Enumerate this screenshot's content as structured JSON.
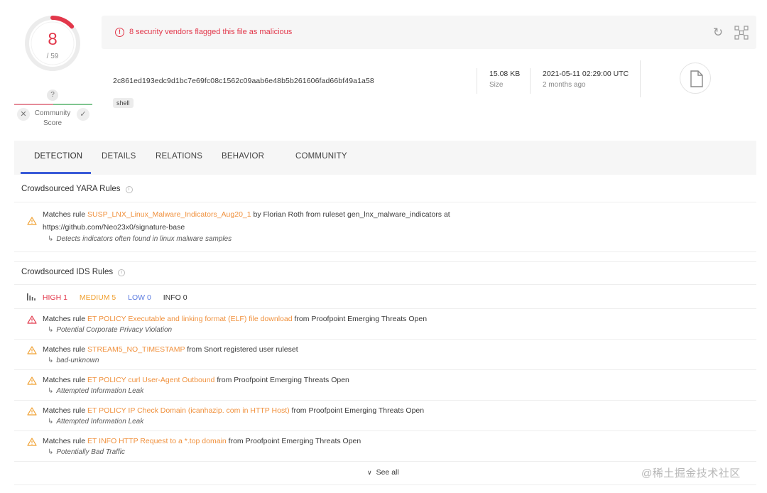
{
  "score": {
    "detected": "8",
    "total": "/ 59",
    "detected_fraction": 0.1356
  },
  "community": {
    "question": "?",
    "label_line1": "Community",
    "label_line2": "Score",
    "down": "✕",
    "up": "✓"
  },
  "alert": {
    "text": "8 security vendors flagged this file as malicious",
    "icon": "!"
  },
  "file": {
    "hash": "2c861ed193edc9d1bc7e69fc08c1562c09aab6e48b5b261606fad66bf49a1a58",
    "tag": "shell",
    "size_value": "15.08 KB",
    "size_label": "Size",
    "date_value": "2021-05-11 02:29:00 UTC",
    "date_label": "2 months ago"
  },
  "tabs": [
    "DETECTION",
    "DETAILS",
    "RELATIONS",
    "BEHAVIOR",
    "COMMUNITY"
  ],
  "yara": {
    "title": "Crowdsourced YARA Rules",
    "rule": {
      "prefix": "Matches rule ",
      "name": "SUSP_LNX_Linux_Malware_Indicators_Aug20_1",
      "suffix": " by Florian Roth from ruleset gen_lnx_malware_indicators at",
      "line2": "https://github.com/Neo23x0/signature-base",
      "desc": "Detects indicators often found in linux malware samples"
    }
  },
  "ids": {
    "title": "Crowdsourced IDS Rules",
    "severity": {
      "high": "HIGH 1",
      "medium": "MEDIUM 5",
      "low": "LOW 0",
      "info": "INFO 0"
    },
    "rules": [
      {
        "prefix": "Matches rule ",
        "name": "ET POLICY Executable and linking format (ELF) file download",
        "suffix": " from Proofpoint Emerging Threats Open",
        "desc": "Potential Corporate Privacy Violation",
        "level": "high"
      },
      {
        "prefix": "Matches rule ",
        "name": "STREAM5_NO_TIMESTAMP",
        "suffix": " from Snort registered user ruleset",
        "desc": "bad-unknown",
        "level": "medium"
      },
      {
        "prefix": "Matches rule ",
        "name": "ET POLICY curl User-Agent Outbound",
        "suffix": " from Proofpoint Emerging Threats Open",
        "desc": "Attempted Information Leak",
        "level": "medium"
      },
      {
        "prefix": "Matches rule ",
        "name": "ET POLICY IP Check Domain (icanhazip. com in HTTP Host)",
        "suffix": " from Proofpoint Emerging Threats Open",
        "desc": "Attempted Information Leak",
        "level": "medium"
      },
      {
        "prefix": "Matches rule ",
        "name": "ET INFO HTTP Request to a *.top domain",
        "suffix": " from Proofpoint Emerging Threats Open",
        "desc": "Potentially Bad Traffic",
        "level": "medium"
      }
    ],
    "see_all": "See all"
  },
  "watermark": "@稀土掘金技术社区",
  "colors": {
    "malicious": "#e2374a",
    "link": "#f0913d",
    "high": "#e2374a",
    "medium": "#f0a030",
    "low": "#5b7be0",
    "info": "#333333",
    "tab_active": "#3a5bd8"
  },
  "icons": {
    "reload": "reload-icon",
    "graph": "graph-icon",
    "file": "file-icon",
    "warning": "warning-icon",
    "info": "info-icon",
    "chevron": "chevron-down-icon"
  }
}
